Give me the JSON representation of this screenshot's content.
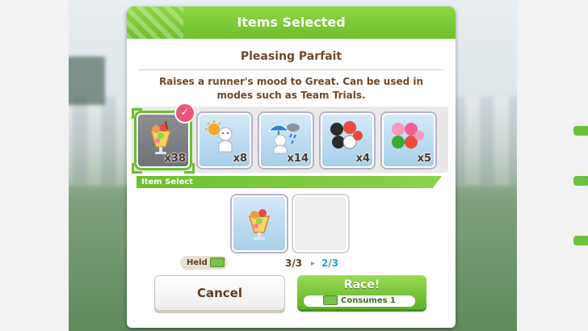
{
  "dialog": {
    "title": "Items Selected",
    "item_name": "Pleasing Parfait",
    "item_description": "Raises a runner's mood to Great. Can be used in modes such as Team Trials."
  },
  "inventory": [
    {
      "icon": "parfait-icon",
      "count": "x38",
      "selected": true
    },
    {
      "icon": "sunny-weather-icon",
      "count": "x8",
      "selected": false
    },
    {
      "icon": "rainy-weather-icon",
      "count": "x14",
      "selected": false
    },
    {
      "icon": "billiard-balls-icon",
      "count": "x4",
      "selected": false
    },
    {
      "icon": "pink-billiard-balls-icon",
      "count": "x5",
      "selected": false
    }
  ],
  "item_select": {
    "section_label": "Item Select",
    "held_label": "Held",
    "held_count": "3/3",
    "after_count": "2/3",
    "arrow": "▸"
  },
  "buttons": {
    "cancel_label": "Cancel",
    "race_label": "Race!",
    "consumes_label": "Consumes 1"
  },
  "colors": {
    "accent_green": "#6cc02c",
    "selected_badge": "#ee5478",
    "text_brown": "#6b4a28",
    "after_blue": "#2a9be0"
  }
}
